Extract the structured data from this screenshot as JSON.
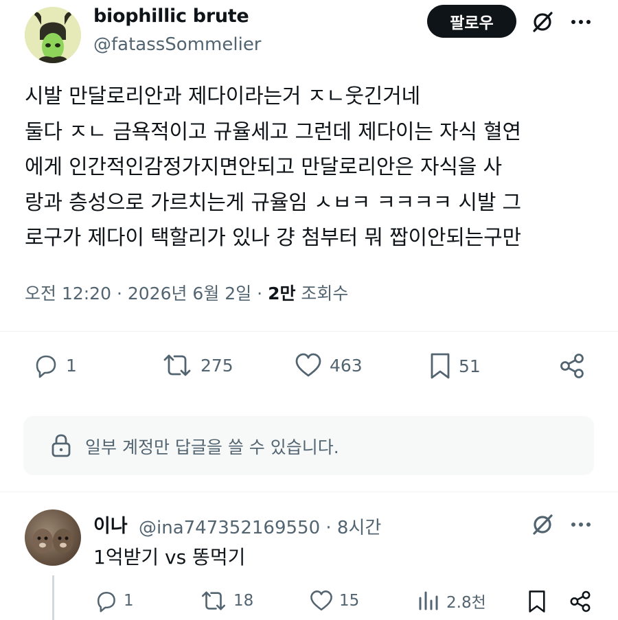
{
  "author": {
    "display_name": "biophillic brute",
    "handle": "@fatassSommelier"
  },
  "follow_button_label": "팔로우",
  "tweet": {
    "text": "시발 만달로리안과 제다이라는거 ㅈㄴ웃긴거네\n둘다 ㅈㄴ 금욕적이고 규율세고 그런데 제다이는 자식 혈연\n에게 인간적인감정가지면안되고 만달로리안은 자식을 사\n랑과 층성으로 가르치는게 규율임 ㅅㅂㅋ ㅋㅋㅋㅋ 시발 그\n로구가 제다이 택할리가 있나 걍 첨부터 뭐 짭이안되는구만",
    "time": "오전 12:20",
    "date": "2026년 6월 2일",
    "sep": "·",
    "views_count": "2만",
    "views_label": "조회수"
  },
  "actions": {
    "replies": "1",
    "retweets": "275",
    "likes": "463",
    "bookmarks": "51"
  },
  "reply_restriction": "일부 계정만 답글을 쓸 수 있습니다.",
  "reply": {
    "display_name": "이나",
    "handle_time": "@ina747352169550 · 8시간",
    "text": "1억받기 vs 똥먹기",
    "actions": {
      "replies": "1",
      "retweets": "18",
      "likes": "15",
      "views": "2.8천"
    }
  },
  "colors": {
    "text": "#0f1419",
    "secondary": "#536471",
    "divider": "#eff3f4",
    "reply_box_bg": "#f7f9f9",
    "button_bg": "#0f1419"
  },
  "icons": [
    "grok-icon",
    "more-icon",
    "reply-icon",
    "retweet-icon",
    "like-icon",
    "bookmark-icon",
    "share-icon",
    "lock-icon",
    "views-icon"
  ]
}
